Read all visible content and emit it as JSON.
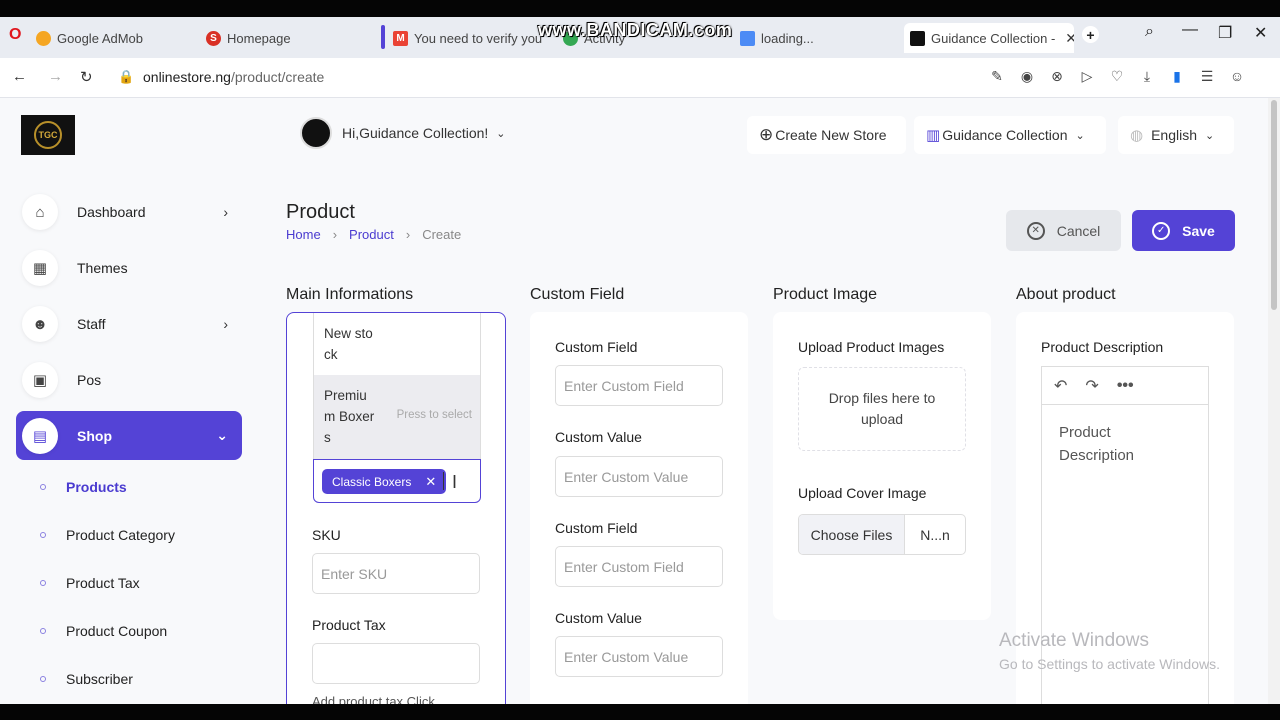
{
  "browser": {
    "recorder_watermark": "www.BANDICAM.com",
    "tabs": [
      {
        "label": "Google AdMob",
        "icon": "admob-icon"
      },
      {
        "label": "Homepage",
        "icon": "s-icon"
      },
      {
        "label": "You need to verify your ",
        "icon": "gmail-icon"
      },
      {
        "label": "Activity",
        "icon": "google-icon"
      },
      {
        "label": "loading...",
        "icon": "loading-icon"
      },
      {
        "label": "Guidance Collection -",
        "icon": "store-icon"
      }
    ],
    "url_host": "onlinestore.ng",
    "url_path": "/product/create"
  },
  "header": {
    "greeting": "Hi,Guidance Collection!",
    "create_store": "Create New Store",
    "store_name": "Guidance Collection",
    "language": "English"
  },
  "logo": {
    "text": "TGC"
  },
  "sidebar": {
    "items": [
      {
        "label": "Dashboard"
      },
      {
        "label": "Themes"
      },
      {
        "label": "Staff"
      },
      {
        "label": "Pos"
      },
      {
        "label": "Shop"
      }
    ],
    "sub_items": [
      {
        "label": "Products"
      },
      {
        "label": "Product Category"
      },
      {
        "label": "Product Tax"
      },
      {
        "label": "Product Coupon"
      },
      {
        "label": "Subscriber"
      }
    ]
  },
  "page": {
    "title": "Product",
    "breadcrumb": [
      "Home",
      "Product",
      "Create"
    ],
    "cancel_label": "Cancel",
    "save_label": "Save"
  },
  "sections": {
    "main": "Main Informations",
    "custom": "Custom Field",
    "image": "Product Image",
    "about": "About product"
  },
  "main_info": {
    "dropdown_options": [
      "New sto",
      "ck",
      "Premiu",
      "m Boxer",
      "s"
    ],
    "dropdown_hint": "Press to select",
    "selected_tag": "Classic Boxers",
    "sku_label": "SKU",
    "sku_placeholder": "Enter SKU",
    "tax_label": "Product Tax",
    "tax_value": "",
    "tax_help": "Add product tax Click"
  },
  "custom_fields": {
    "field1_label": "Custom Field",
    "field1_placeholder": "Enter Custom Field",
    "value1_label": "Custom Value",
    "value1_placeholder": "Enter Custom Value",
    "field2_label": "Custom Field",
    "field2_placeholder": "Enter Custom Field",
    "value2_label": "Custom Value",
    "value2_placeholder": "Enter Custom Value"
  },
  "product_image": {
    "upload_label": "Upload Product Images",
    "drop_text_1": "Drop files here to",
    "drop_text_2": "upload",
    "cover_label": "Upload Cover Image",
    "choose_files": "Choose Files",
    "file_name": "N...n"
  },
  "about": {
    "desc_label": "Product Description",
    "desc_placeholder_1": "Product",
    "desc_placeholder_2": "Description"
  },
  "os": {
    "activate_title": "Activate Windows",
    "activate_sub": "Go to Settings to activate Windows."
  },
  "colors": {
    "accent": "#5443d6",
    "page_bg": "#f8f9fb"
  }
}
